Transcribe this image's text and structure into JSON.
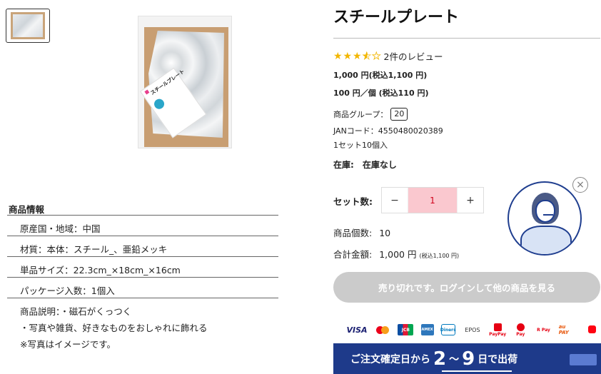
{
  "product": {
    "title": "スチールプレート",
    "rating": 3.5,
    "review_text": "2件のレビュー",
    "price": "1,000 円(税込1,100 円)",
    "unit_price": "100 円／個 (税込110 円)",
    "group_label": "商品グループ：",
    "group_value": "20",
    "jan": "JANコード：4550480020389",
    "set_count": "1セット10個入",
    "stock_label": "在庫:",
    "stock_value": "在庫なし",
    "image_label_text": "スチールプレート"
  },
  "quantity": {
    "label": "セット数:",
    "minus": "−",
    "value": "1",
    "plus": "+"
  },
  "count": {
    "label": "商品個数:",
    "value": "10"
  },
  "total": {
    "label": "合計金額:",
    "value": "1,000 円",
    "tax": "(税込1,100 円)"
  },
  "cta_label": "売り切れです。ログインして他の商品を見る",
  "info": {
    "title": "商品情報",
    "rows": [
      "原産国・地域：中国",
      "材質：本体：スチール_、亜鉛メッキ",
      "単品サイズ：22.3cm_×18cm_×16cm",
      "パッケージ入数：1個入"
    ],
    "description": [
      "商品説明：・磁石がくっつく",
      "・写真や雑貨、好きなものをおしゃれに飾れる",
      "※写真はイメージです。"
    ]
  },
  "payments": {
    "visa": "VISA",
    "jcb": "JCB",
    "amex": "AMEX",
    "diners": "Diners",
    "epos": "EPOS",
    "paypay": "PayPay",
    "dpay": "Pay",
    "rpay": "R Pay",
    "aupay": "au PAY",
    "merpay": "merpay"
  },
  "banner": {
    "prefix": "ご注文確定日から",
    "num1": "2",
    "sep": "〜",
    "num2": "9",
    "suffix": "日で出荷"
  },
  "chat_close": "×",
  "colors": {
    "star": "#f2b600",
    "stepper_bg": "#fac8cf",
    "banner": "#1e3a8a",
    "cta_disabled": "#cbcbcb"
  }
}
